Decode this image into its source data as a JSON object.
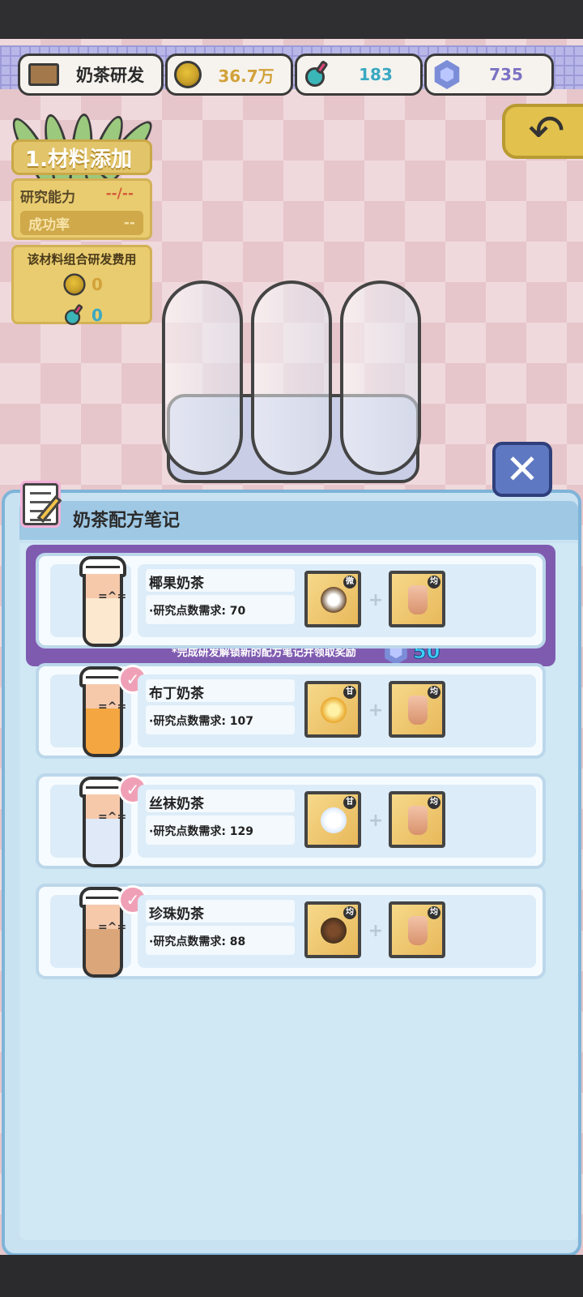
{
  "header": {
    "title": "奶茶研发",
    "coins": "36.7万",
    "research_points": "183",
    "gems": "735"
  },
  "left_panel": {
    "step_label": "1.材料添加",
    "research_ability_label": "研究能力",
    "research_ability_value": "--/--",
    "success_rate_label": "成功率",
    "success_rate_value": "--",
    "cost_title": "该材料组合研发费用",
    "cost_coins": "0",
    "cost_points": "0"
  },
  "recipe_panel": {
    "title": "奶茶配方笔记",
    "unlock_hint": "*完成研发解锁新的配方笔记并领取奖励",
    "reward_amount": "50",
    "recipes": [
      {
        "name": "椰果奶茶",
        "requirement": "·研究点数需求: 70",
        "completed": false,
        "liquid_color": "#fbe8cf",
        "ingredient1_tag": "微",
        "ingredient1_icon": "coconut-jelly-icon",
        "ingredient2_tag": "均",
        "ingredient2_icon": "milk-tea-base-icon"
      },
      {
        "name": "布丁奶茶",
        "requirement": "·研究点数需求: 107",
        "completed": true,
        "liquid_color": "#f4a640",
        "ingredient1_tag": "甘",
        "ingredient1_icon": "pudding-icon",
        "ingredient2_tag": "均",
        "ingredient2_icon": "milk-tea-base-icon"
      },
      {
        "name": "丝袜奶茶",
        "requirement": "·研究点数需求: 129",
        "completed": true,
        "liquid_color": "#dfe9f7",
        "ingredient1_tag": "甘",
        "ingredient1_icon": "sugar-cube-icon",
        "ingredient2_tag": "均",
        "ingredient2_icon": "milk-tea-base-icon"
      },
      {
        "name": "珍珠奶茶",
        "requirement": "·研究点数需求: 88",
        "completed": true,
        "liquid_color": "#dba67a",
        "ingredient1_tag": "均",
        "ingredient1_icon": "tapioca-pearl-icon",
        "ingredient2_tag": "均",
        "ingredient2_icon": "milk-tea-base-icon"
      }
    ]
  },
  "colors": {
    "accent_purple": "#7f5bb0",
    "gold": "#e2c46a",
    "panel_blue": "#c8e2f2"
  }
}
